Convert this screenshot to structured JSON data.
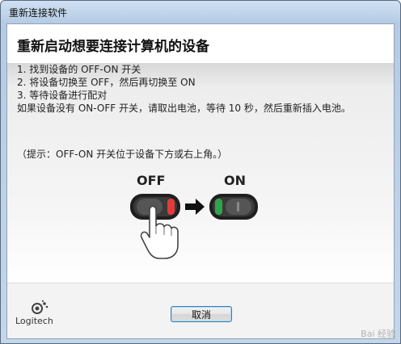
{
  "window": {
    "title": "重新连接软件"
  },
  "header": {
    "heading": "重新启动想要连接计算机的设备"
  },
  "instructions": {
    "steps": [
      "1. 找到设备的 OFF-ON 开关",
      "2. 将设备切换至 OFF，然后再切换至 ON",
      "3. 等待设备进行配对"
    ],
    "note": "如果设备没有 ON-OFF 开关，请取出电池，等待 10 秒，然后重新插入电池。",
    "tip": "（提示：OFF-ON 开关位于设备下方或右上角。）"
  },
  "illustration": {
    "off_label": "OFF",
    "on_label": "ON",
    "colors": {
      "off_accent": "#e23b3b",
      "on_accent": "#2fa34a",
      "switch_body": "#2b2b2b"
    }
  },
  "footer": {
    "logo_text": "Logitech",
    "cancel_label": "取消"
  },
  "watermark": "Bai 经验"
}
